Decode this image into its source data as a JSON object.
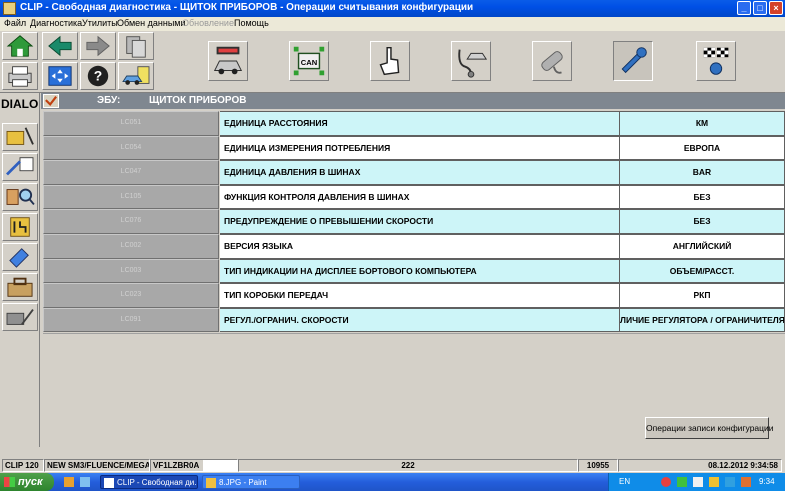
{
  "window": {
    "title": "CLIP - Свободная диагностика - ЩИТОК ПРИБОРОВ - Операции считывания конфигурации",
    "min": "_",
    "max": "□",
    "close": "×"
  },
  "menu": [
    "Файл",
    "Диагностика",
    "Утилиты",
    "Обмен данными",
    "Обновление",
    "Помощь"
  ],
  "toolbar": {
    "can_label": "CAN"
  },
  "side": {
    "dialog_label": "DIALO"
  },
  "ecu": {
    "label": "ЭБУ:",
    "value": "ЩИТОК ПРИБОРОВ"
  },
  "rows": [
    {
      "code": "LC051",
      "name": "ЕДИНИЦА РАССТОЯНИЯ",
      "value": "КМ"
    },
    {
      "code": "LC054",
      "name": "ЕДИНИЦА ИЗМЕРЕНИЯ ПОТРЕБЛЕНИЯ",
      "value": "ЕВРОПА"
    },
    {
      "code": "LC047",
      "name": "ЕДИНИЦА ДАВЛЕНИЯ В ШИНАХ",
      "value": "BAR"
    },
    {
      "code": "LC105",
      "name": "ФУНКЦИЯ КОНТРОЛЯ ДАВЛЕНИЯ В ШИНАХ",
      "value": "БЕЗ"
    },
    {
      "code": "LC076",
      "name": "ПРЕДУПРЕЖДЕНИЕ О ПРЕВЫШЕНИИ СКОРОСТИ",
      "value": "БЕЗ"
    },
    {
      "code": "LC002",
      "name": "ВЕРСИЯ ЯЗЫКА",
      "value": "АНГЛИЙСКИЙ"
    },
    {
      "code": "LC003",
      "name": "ТИП ИНДИКАЦИИ НА ДИСПЛЕЕ БОРТОВОГО КОМПЬЮТЕРА",
      "value": "ОБЪЕМ/РАССТ."
    },
    {
      "code": "LC023",
      "name": "ТИП КОРОБКИ ПЕРЕДАЧ",
      "value": "РКП"
    },
    {
      "code": "LC091",
      "name": "РЕГУЛ./ОГРАНИЧ. СКОРОСТИ",
      "value": "ЛИЧИЕ РЕГУЛЯТОРА / ОГРАНИЧИТЕЛЯ СІ"
    }
  ],
  "write_button": "Операции записи конфигурации",
  "status": {
    "clip": "CLIP 120",
    "vehicle": "NEW SM3/FLUENCE/MEGA",
    "vin": "VF1LZBR0A",
    "code": "222",
    "num": "10955",
    "datetime": "08.12.2012 9:34:58"
  },
  "taskbar": {
    "start": "пуск",
    "task1": "CLIP - Свободная ди...",
    "task2": "8.JPG - Paint",
    "lang": "EN",
    "time": "9:34"
  },
  "colors": {
    "row_cyan": "#cdf5f8",
    "row_white": "#ffffff",
    "ecu_bar": "#7f8790",
    "titlebar": "#0050e6"
  }
}
